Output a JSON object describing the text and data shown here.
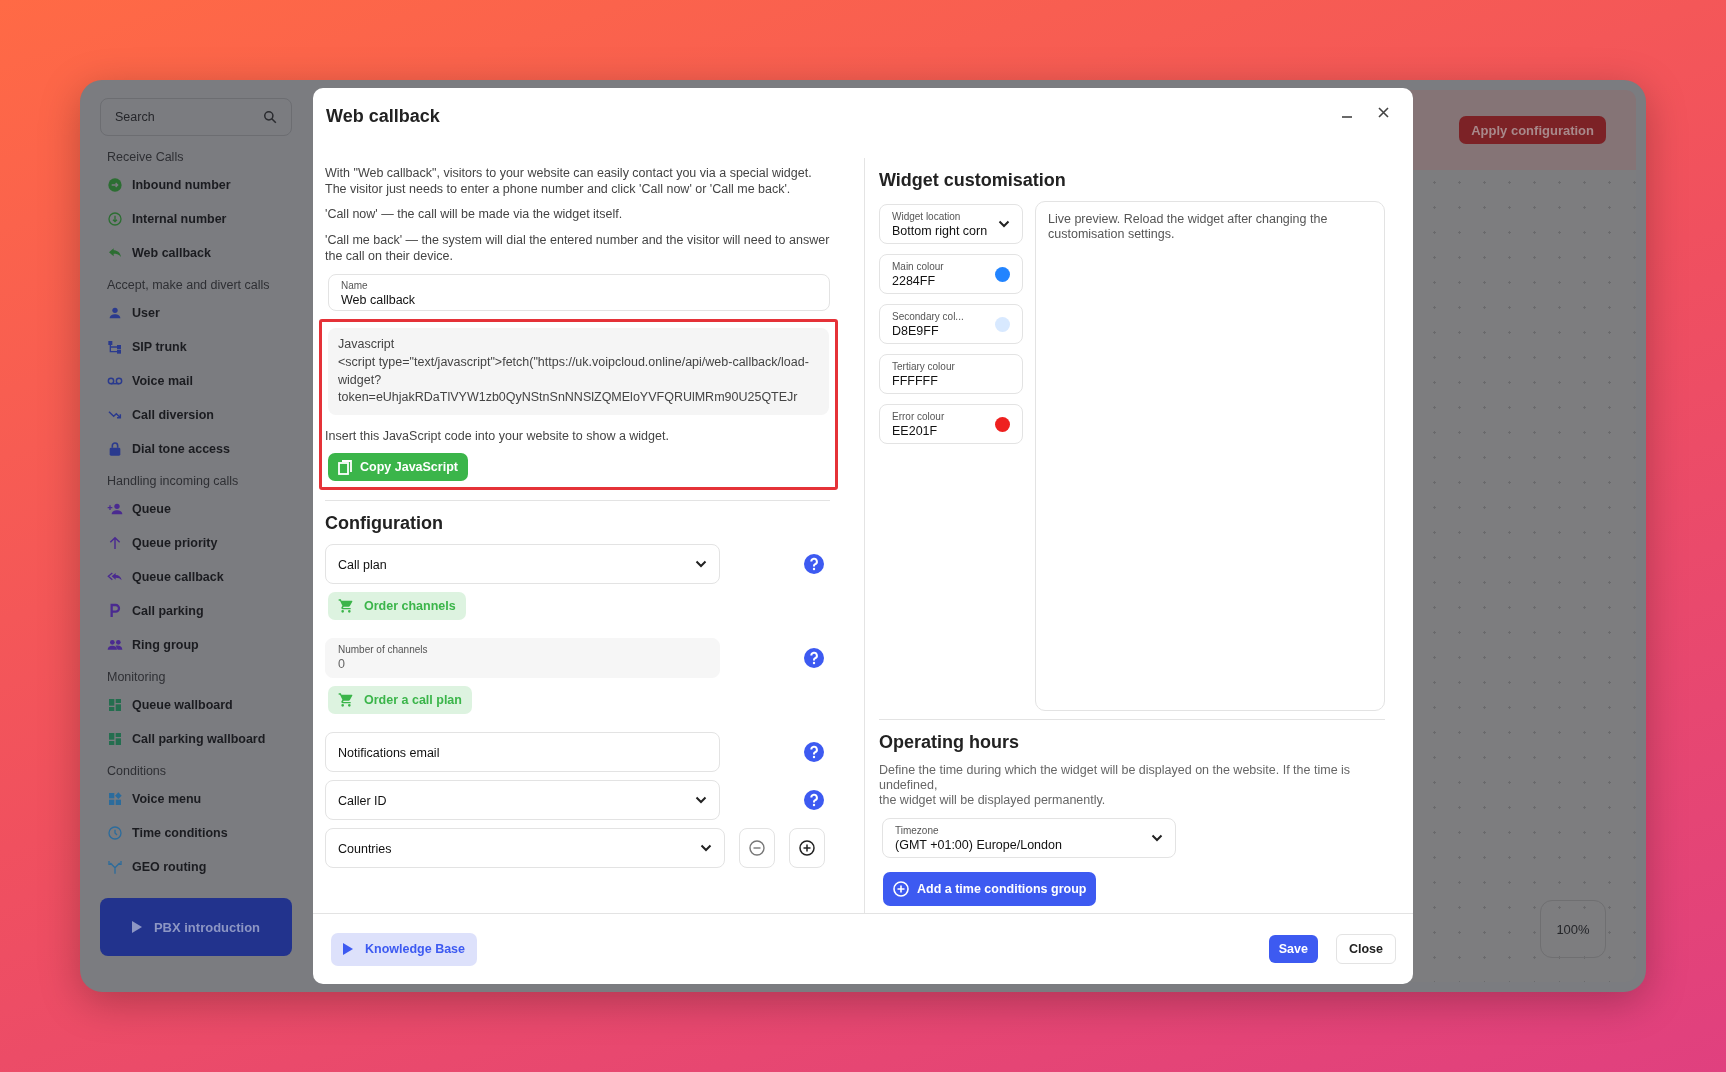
{
  "sidebar": {
    "search": {
      "placeholder": "Search"
    },
    "sections": [
      {
        "title": "Receive Calls",
        "items": [
          {
            "label": "Inbound number"
          },
          {
            "label": "Internal number"
          },
          {
            "label": "Web callback"
          }
        ]
      },
      {
        "title": "Accept, make and divert calls",
        "items": [
          {
            "label": "User"
          },
          {
            "label": "SIP trunk"
          },
          {
            "label": "Voice mail"
          },
          {
            "label": "Call diversion"
          },
          {
            "label": "Dial tone access"
          }
        ]
      },
      {
        "title": "Handling incoming calls",
        "items": [
          {
            "label": "Queue"
          },
          {
            "label": "Queue priority"
          },
          {
            "label": "Queue callback"
          },
          {
            "label": "Call parking"
          },
          {
            "label": "Ring group"
          }
        ]
      },
      {
        "title": "Monitoring",
        "items": [
          {
            "label": "Queue wallboard"
          },
          {
            "label": "Call parking wallboard"
          }
        ]
      },
      {
        "title": "Conditions",
        "items": [
          {
            "label": "Voice menu"
          },
          {
            "label": "Time conditions"
          },
          {
            "label": "GEO routing"
          }
        ]
      }
    ],
    "promo_button": "PBX introduction"
  },
  "topbar": {
    "apply_button": "Apply configuration"
  },
  "zoom_level": "100%",
  "dialog": {
    "title": "Web callback",
    "description": [
      "With \"Web callback\", visitors to your website can easily contact you via a special widget. The visitor just needs to enter a phone number and click 'Call now' or 'Call me back'.",
      "'Call now' — the call will be made via the widget itself.",
      "'Call me back' — the system will dial the entered number and the visitor will need to answer the call on their device."
    ],
    "name_field": {
      "label": "Name",
      "value": "Web callback"
    },
    "javascript": {
      "label": "Javascript",
      "code": "<script type=\"text/javascript\">fetch(\"https://uk.voipcloud.online/api/web-callback/load-widget?token=eUhjakRDaTlVYW1zb0QyNStnSnNNSlZQMEloYVFQRUlMRm90U25QTEJr",
      "hint": "Insert this JavaScript code into your website to show a widget.",
      "copy_button": "Copy JavaScript"
    },
    "configuration": {
      "title": "Configuration",
      "fields": [
        {
          "kind": "select",
          "label": "Call plan",
          "help": true,
          "stepper": false
        },
        {
          "kind": "order",
          "label": "Order channels"
        },
        {
          "kind": "readonly",
          "label": "Number of channels",
          "value": "0",
          "help": true,
          "stepper": false
        },
        {
          "kind": "order",
          "label": "Order a call plan"
        },
        {
          "kind": "text",
          "label": "Notifications email",
          "help": true,
          "stepper": false
        },
        {
          "kind": "select",
          "label": "Caller ID",
          "help": true,
          "stepper": false
        },
        {
          "kind": "select",
          "label": "Countries",
          "help": false,
          "stepper": true
        }
      ]
    },
    "widget": {
      "title": "Widget customisation",
      "location": {
        "label": "Widget location",
        "value": "Bottom right corn"
      },
      "colours": [
        {
          "label": "Main colour",
          "value": "2284FF",
          "color": "#2284ff"
        },
        {
          "label": "Secondary col...",
          "value": "D8E9FF",
          "color": "#d8e9ff"
        },
        {
          "label": "Tertiary colour",
          "value": "FFFFFF"
        },
        {
          "label": "Error colour",
          "value": "EE201F",
          "color": "#ee201f"
        }
      ],
      "preview_text": "Live preview. Reload the widget after changing the customisation settings."
    },
    "operating_hours": {
      "title": "Operating hours",
      "description": "Define the time during which the widget will be displayed on the website. If the time is undefined,\nthe widget will be displayed permanently.",
      "timezone": {
        "label": "Timezone",
        "value": "(GMT +01:00) Europe/London"
      },
      "add_button": "Add a time conditions group"
    },
    "footer": {
      "knowledge_button": "Knowledge Base",
      "save_button": "Save",
      "close_button": "Close"
    }
  }
}
